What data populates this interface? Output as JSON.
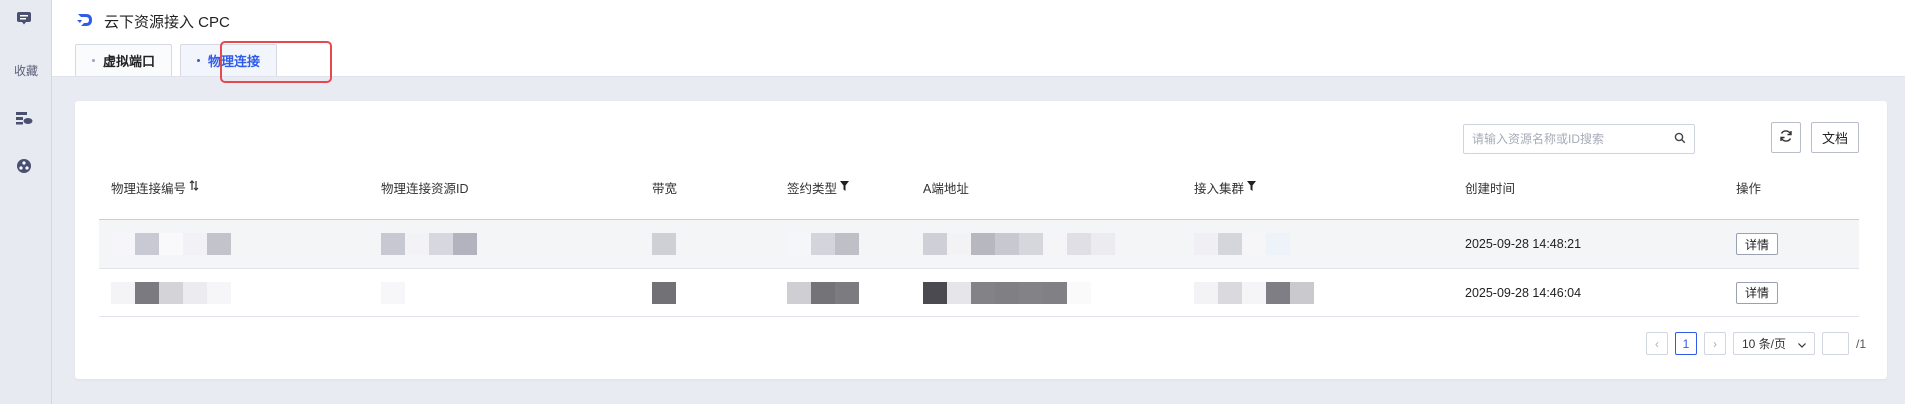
{
  "sidebar": {
    "collect_label": "收藏"
  },
  "header": {
    "title": "云下资源接入 CPC",
    "tabs": [
      {
        "label": "虚拟端口",
        "active": false
      },
      {
        "label": "物理连接",
        "active": true
      }
    ]
  },
  "toolbar": {
    "search_placeholder": "请输入资源名称或ID搜索",
    "refresh_icon": "refresh-icon",
    "doc_label": "文档"
  },
  "table": {
    "columns": [
      "物理连接编号",
      "物理连接资源ID",
      "带宽",
      "签约类型",
      "A端地址",
      "接入集群",
      "创建时间",
      "操作"
    ],
    "rows": [
      {
        "created": "2025-09-28 14:48:21",
        "action": "详情"
      },
      {
        "created": "2025-09-28 14:46:04",
        "action": "详情"
      }
    ]
  },
  "pagination": {
    "current_page": "1",
    "page_size": "10 条/页",
    "total": "/1"
  },
  "colors": {
    "accent": "#2f5bea",
    "highlight": "#e5484d"
  }
}
